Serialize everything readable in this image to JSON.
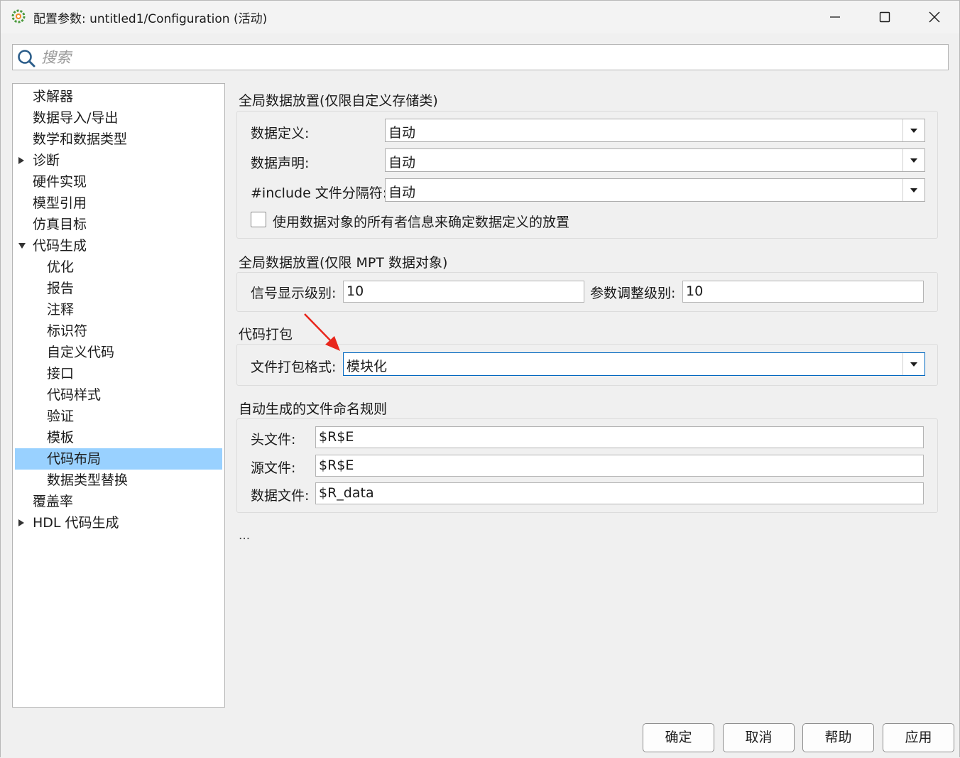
{
  "window": {
    "title": "配置参数: untitled1/Configuration (活动)",
    "icons": {
      "app": "matlab-gear-icon",
      "minimize": "minimize-icon",
      "maximize": "maximize-icon",
      "close": "close-icon"
    }
  },
  "search": {
    "placeholder": "搜索",
    "value": ""
  },
  "tree": {
    "items": [
      {
        "label": "求解器",
        "level": 0,
        "expander": "none"
      },
      {
        "label": "数据导入/导出",
        "level": 0,
        "expander": "none"
      },
      {
        "label": "数学和数据类型",
        "level": 0,
        "expander": "none"
      },
      {
        "label": "诊断",
        "level": 0,
        "expander": "collapsed"
      },
      {
        "label": "硬件实现",
        "level": 0,
        "expander": "none"
      },
      {
        "label": "模型引用",
        "level": 0,
        "expander": "none"
      },
      {
        "label": "仿真目标",
        "level": 0,
        "expander": "none"
      },
      {
        "label": "代码生成",
        "level": 0,
        "expander": "expanded"
      },
      {
        "label": "优化",
        "level": 1,
        "expander": "none"
      },
      {
        "label": "报告",
        "level": 1,
        "expander": "none"
      },
      {
        "label": "注释",
        "level": 1,
        "expander": "none"
      },
      {
        "label": "标识符",
        "level": 1,
        "expander": "none"
      },
      {
        "label": "自定义代码",
        "level": 1,
        "expander": "none"
      },
      {
        "label": "接口",
        "level": 1,
        "expander": "none"
      },
      {
        "label": "代码样式",
        "level": 1,
        "expander": "none"
      },
      {
        "label": "验证",
        "level": 1,
        "expander": "none"
      },
      {
        "label": "模板",
        "level": 1,
        "expander": "none"
      },
      {
        "label": "代码布局",
        "level": 1,
        "expander": "none",
        "selected": true
      },
      {
        "label": "数据类型替换",
        "level": 1,
        "expander": "none"
      },
      {
        "label": "覆盖率",
        "level": 0,
        "expander": "none"
      },
      {
        "label": "HDL 代码生成",
        "level": 0,
        "expander": "collapsed"
      }
    ],
    "selected_color": "#99d1ff"
  },
  "sections": {
    "global_custom": {
      "title": "全局数据放置(仅限自定义存储类)",
      "data_definition_label": "数据定义:",
      "data_definition_value": "自动",
      "data_declaration_label": "数据声明:",
      "data_declaration_value": "自动",
      "include_delimiter_label": "#include 文件分隔符:",
      "include_delimiter_value": "自动",
      "owner_checkbox_label": "使用数据对象的所有者信息来确定数据定义的放置",
      "owner_checkbox_checked": false
    },
    "global_mpt": {
      "title": "全局数据放置(仅限 MPT 数据对象)",
      "signal_level_label": "信号显示级别:",
      "signal_level_value": "10",
      "param_level_label": "参数调整级别:",
      "param_level_value": "10"
    },
    "packaging": {
      "title": "代码打包",
      "file_format_label": "文件打包格式:",
      "file_format_value": "模块化"
    },
    "naming": {
      "title": "自动生成的文件命名规则",
      "header_label": "头文件:",
      "header_value": "$R$E",
      "source_label": "源文件:",
      "source_value": "$R$E",
      "data_label": "数据文件:",
      "data_value": "$R_data"
    },
    "more": "..."
  },
  "buttons": {
    "ok": "确定",
    "cancel": "取消",
    "help": "帮助",
    "apply": "应用"
  },
  "annotation": {
    "arrow_color": "#e8261c"
  }
}
